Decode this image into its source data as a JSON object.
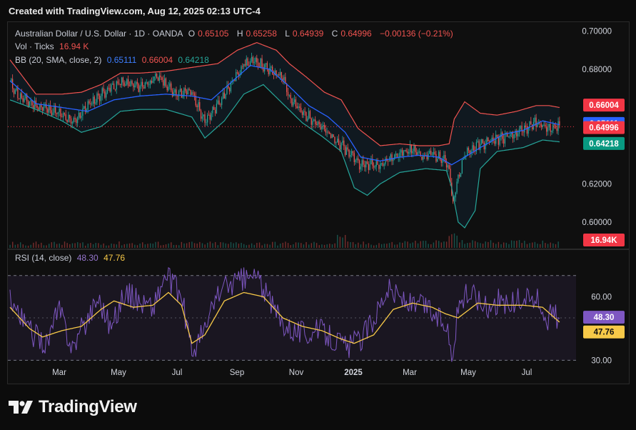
{
  "header": {
    "caption": "Created with TradingView.com, Aug 12, 2025 02:13 UTC-4"
  },
  "legend": {
    "symbol": "Australian Dollar / U.S. Dollar · 1D · OANDA",
    "open_label": "O",
    "open": "0.65105",
    "high_label": "H",
    "high": "0.65258",
    "low_label": "L",
    "low": "0.64939",
    "close_label": "C",
    "close": "0.64996",
    "change": "−0.00136 (−0.21%)",
    "vol_label": "Vol · Ticks",
    "vol_value": "16.94 K",
    "bb_label": "BB (20, SMA, close, 2)",
    "bb_basis": "0.65111",
    "bb_upper": "0.66004",
    "bb_lower": "0.64218",
    "rsi_label": "RSI (14, close)",
    "rsi_value": "48.30",
    "rsi_ma": "47.76"
  },
  "colors": {
    "up": "#26a69a",
    "down": "#ef5350",
    "bb_upper": "#ef5350",
    "bb_basis": "#2962ff",
    "bb_lower": "#26a69a",
    "rsi": "#7e57c2",
    "rsi_ma": "#f7c948",
    "last_price": "#f23645"
  },
  "price_tags": {
    "upper": "0.66004",
    "basis": "0.65111",
    "last": "0.64996",
    "lower": "0.64218",
    "volume": "16.94K",
    "rsi": "48.30",
    "rsi_ma": "47.76"
  },
  "logo": {
    "text": "TradingView"
  },
  "chart_data": {
    "type": "candlestick",
    "price_axis": {
      "ticks": [
        "0.70000",
        "0.68000",
        "0.62000",
        "0.60000"
      ],
      "ylim": [
        0.5865,
        0.7047
      ]
    },
    "rsi_axis": {
      "ticks": [
        "60.00",
        "30.00"
      ],
      "ylim": [
        29.8,
        81.7
      ],
      "bands": [
        70,
        30
      ]
    },
    "x_axis": {
      "labels": [
        "Mar",
        "May",
        "Jul",
        "Sep",
        "Nov",
        "2025",
        "Mar",
        "May",
        "Jul"
      ]
    },
    "price_series": {
      "close": [
        [
          0,
          0.673
        ],
        [
          8,
          0.665
        ],
        [
          20,
          0.661
        ],
        [
          35,
          0.658
        ],
        [
          48,
          0.652
        ],
        [
          60,
          0.661
        ],
        [
          72,
          0.668
        ],
        [
          85,
          0.673
        ],
        [
          100,
          0.671
        ],
        [
          115,
          0.676
        ],
        [
          125,
          0.668
        ],
        [
          140,
          0.668
        ],
        [
          150,
          0.652
        ],
        [
          160,
          0.662
        ],
        [
          170,
          0.672
        ],
        [
          180,
          0.683
        ],
        [
          190,
          0.684
        ],
        [
          200,
          0.679
        ],
        [
          210,
          0.677
        ],
        [
          215,
          0.665
        ],
        [
          225,
          0.657
        ],
        [
          235,
          0.653
        ],
        [
          245,
          0.646
        ],
        [
          255,
          0.64
        ],
        [
          265,
          0.634
        ],
        [
          270,
          0.63
        ],
        [
          280,
          0.63
        ],
        [
          290,
          0.632
        ],
        [
          300,
          0.636
        ],
        [
          310,
          0.638
        ],
        [
          318,
          0.634
        ],
        [
          325,
          0.636
        ],
        [
          335,
          0.632
        ],
        [
          338,
          0.628
        ],
        [
          341,
          0.608
        ],
        [
          344,
          0.62
        ],
        [
          350,
          0.636
        ],
        [
          360,
          0.64
        ],
        [
          372,
          0.643
        ],
        [
          385,
          0.645
        ],
        [
          395,
          0.648
        ],
        [
          405,
          0.652
        ],
        [
          415,
          0.649
        ],
        [
          423,
          0.65
        ]
      ],
      "bb_upper": [
        [
          0,
          0.685
        ],
        [
          20,
          0.667
        ],
        [
          40,
          0.667
        ],
        [
          55,
          0.668
        ],
        [
          70,
          0.672
        ],
        [
          85,
          0.678
        ],
        [
          100,
          0.678
        ],
        [
          120,
          0.679
        ],
        [
          140,
          0.681
        ],
        [
          160,
          0.683
        ],
        [
          175,
          0.69
        ],
        [
          190,
          0.694
        ],
        [
          205,
          0.69
        ],
        [
          215,
          0.683
        ],
        [
          228,
          0.676
        ],
        [
          242,
          0.668
        ],
        [
          255,
          0.664
        ],
        [
          268,
          0.649
        ],
        [
          285,
          0.64
        ],
        [
          300,
          0.641
        ],
        [
          315,
          0.64
        ],
        [
          330,
          0.64
        ],
        [
          338,
          0.641
        ],
        [
          342,
          0.654
        ],
        [
          350,
          0.663
        ],
        [
          362,
          0.657
        ],
        [
          375,
          0.656
        ],
        [
          390,
          0.658
        ],
        [
          405,
          0.661
        ],
        [
          415,
          0.661
        ],
        [
          423,
          0.66
        ]
      ],
      "bb_basis": [
        [
          0,
          0.674
        ],
        [
          20,
          0.662
        ],
        [
          40,
          0.66
        ],
        [
          60,
          0.658
        ],
        [
          80,
          0.664
        ],
        [
          100,
          0.666
        ],
        [
          120,
          0.667
        ],
        [
          140,
          0.666
        ],
        [
          155,
          0.664
        ],
        [
          170,
          0.673
        ],
        [
          185,
          0.682
        ],
        [
          200,
          0.68
        ],
        [
          215,
          0.671
        ],
        [
          230,
          0.661
        ],
        [
          245,
          0.655
        ],
        [
          258,
          0.647
        ],
        [
          270,
          0.634
        ],
        [
          285,
          0.632
        ],
        [
          300,
          0.634
        ],
        [
          315,
          0.635
        ],
        [
          330,
          0.634
        ],
        [
          340,
          0.63
        ],
        [
          350,
          0.634
        ],
        [
          362,
          0.639
        ],
        [
          380,
          0.646
        ],
        [
          395,
          0.648
        ],
        [
          410,
          0.653
        ],
        [
          423,
          0.651
        ]
      ],
      "bb_lower": [
        [
          0,
          0.664
        ],
        [
          20,
          0.659
        ],
        [
          40,
          0.653
        ],
        [
          55,
          0.647
        ],
        [
          70,
          0.65
        ],
        [
          85,
          0.658
        ],
        [
          100,
          0.659
        ],
        [
          120,
          0.659
        ],
        [
          140,
          0.655
        ],
        [
          150,
          0.644
        ],
        [
          165,
          0.653
        ],
        [
          180,
          0.667
        ],
        [
          195,
          0.672
        ],
        [
          210,
          0.662
        ],
        [
          225,
          0.652
        ],
        [
          240,
          0.645
        ],
        [
          255,
          0.637
        ],
        [
          265,
          0.618
        ],
        [
          275,
          0.614
        ],
        [
          285,
          0.62
        ],
        [
          300,
          0.626
        ],
        [
          320,
          0.628
        ],
        [
          336,
          0.627
        ],
        [
          340,
          0.618
        ],
        [
          345,
          0.6
        ],
        [
          350,
          0.597
        ],
        [
          358,
          0.606
        ],
        [
          362,
          0.628
        ],
        [
          375,
          0.637
        ],
        [
          395,
          0.639
        ],
        [
          410,
          0.643
        ],
        [
          423,
          0.642
        ]
      ],
      "upper_fill_top": 0.7047
    },
    "rsi_series": {
      "rsi": [
        [
          0,
          62
        ],
        [
          8,
          50
        ],
        [
          18,
          42
        ],
        [
          28,
          38
        ],
        [
          38,
          54
        ],
        [
          48,
          36
        ],
        [
          58,
          48
        ],
        [
          68,
          60
        ],
        [
          78,
          45
        ],
        [
          88,
          62
        ],
        [
          100,
          58
        ],
        [
          110,
          55
        ],
        [
          120,
          70
        ],
        [
          132,
          60
        ],
        [
          140,
          34
        ],
        [
          150,
          44
        ],
        [
          160,
          62
        ],
        [
          170,
          66
        ],
        [
          180,
          68
        ],
        [
          190,
          70
        ],
        [
          200,
          57
        ],
        [
          210,
          48
        ],
        [
          220,
          44
        ],
        [
          230,
          43
        ],
        [
          240,
          44
        ],
        [
          250,
          40
        ],
        [
          260,
          36
        ],
        [
          270,
          40
        ],
        [
          280,
          50
        ],
        [
          290,
          64
        ],
        [
          300,
          60
        ],
        [
          310,
          55
        ],
        [
          320,
          56
        ],
        [
          328,
          50
        ],
        [
          336,
          48
        ],
        [
          340,
          32
        ],
        [
          346,
          58
        ],
        [
          356,
          62
        ],
        [
          366,
          55
        ],
        [
          376,
          58
        ],
        [
          386,
          56
        ],
        [
          396,
          60
        ],
        [
          406,
          58
        ],
        [
          414,
          50
        ],
        [
          420,
          52
        ],
        [
          423,
          48
        ]
      ],
      "rsi_ma": [
        [
          0,
          55
        ],
        [
          15,
          45
        ],
        [
          25,
          41
        ],
        [
          40,
          44
        ],
        [
          55,
          46
        ],
        [
          70,
          54
        ],
        [
          80,
          58
        ],
        [
          95,
          55
        ],
        [
          110,
          56
        ],
        [
          122,
          62
        ],
        [
          132,
          56
        ],
        [
          140,
          38
        ],
        [
          150,
          42
        ],
        [
          165,
          58
        ],
        [
          180,
          62
        ],
        [
          195,
          60
        ],
        [
          210,
          50
        ],
        [
          225,
          46
        ],
        [
          240,
          44
        ],
        [
          255,
          40
        ],
        [
          265,
          38
        ],
        [
          280,
          42
        ],
        [
          295,
          54
        ],
        [
          310,
          57
        ],
        [
          325,
          55
        ],
        [
          335,
          52
        ],
        [
          345,
          50
        ],
        [
          360,
          57
        ],
        [
          375,
          56
        ],
        [
          395,
          56
        ],
        [
          410,
          55
        ],
        [
          423,
          48
        ]
      ]
    }
  }
}
